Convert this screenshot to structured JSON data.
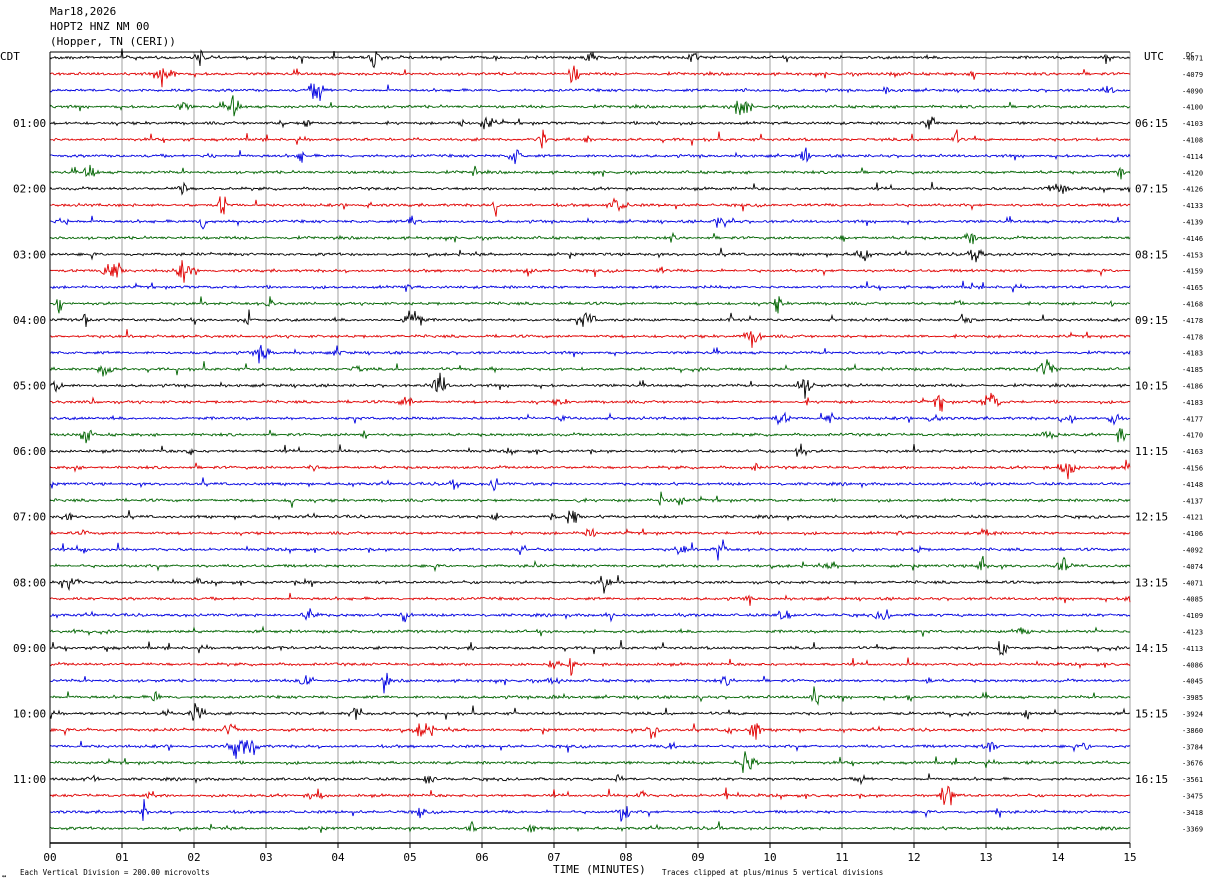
{
  "header": {
    "date": "Mar18,2026",
    "station": "HOPT2 HNZ NM 00",
    "location": "(Hopper, TN (CERI))"
  },
  "left_timezone": "CDT",
  "right_timezone": "UTC",
  "dc_label": "DC",
  "footer": {
    "scale_note": "Each Vertical Division =  200.00 microvolts",
    "clip_note": "Traces clipped at plus/minus 5 vertical divisions",
    "corner_mark": "↔"
  },
  "chart_data": {
    "type": "line",
    "title": "",
    "xlabel": "TIME (MINUTES)",
    "ylabel": "",
    "xlim": [
      0,
      15
    ],
    "x_ticks": [
      "00",
      "01",
      "02",
      "03",
      "04",
      "05",
      "06",
      "07",
      "08",
      "09",
      "10",
      "11",
      "12",
      "13",
      "14",
      "15"
    ],
    "traces_per_hour": 4,
    "trace_colors": [
      "#000000",
      "#e00000",
      "#0000e0",
      "#006400"
    ],
    "left_hour_labels": [
      "01:00",
      "02:00",
      "03:00",
      "04:00",
      "05:00",
      "06:00",
      "07:00",
      "08:00",
      "09:00",
      "10:00",
      "11:00"
    ],
    "right_hour_labels": [
      "06:15",
      "07:15",
      "08:15",
      "09:15",
      "10:15",
      "11:15",
      "12:15",
      "13:15",
      "14:15",
      "15:15",
      "16:15"
    ],
    "dc_offsets": [
      "-4071",
      "-4079",
      "-4090",
      "-4100",
      "-4103",
      "-4108",
      "-4114",
      "-4120",
      "-4126",
      "-4133",
      "-4139",
      "-4146",
      "-4153",
      "-4159",
      "-4165",
      "-4168",
      "-4178",
      "-4178",
      "-4183",
      "-4185",
      "-4186",
      "-4183",
      "-4177",
      "-4170",
      "-4163",
      "-4156",
      "-4148",
      "-4137",
      "-4121",
      "-4106",
      "-4092",
      "-4074",
      "-4071",
      "-4085",
      "-4109",
      "-4123",
      "-4113",
      "-4086",
      "-4045",
      "-3985",
      "-3924",
      "-3860",
      "-3784",
      "-3676",
      "-3561",
      "-3475",
      "-3418",
      "-3369"
    ]
  }
}
